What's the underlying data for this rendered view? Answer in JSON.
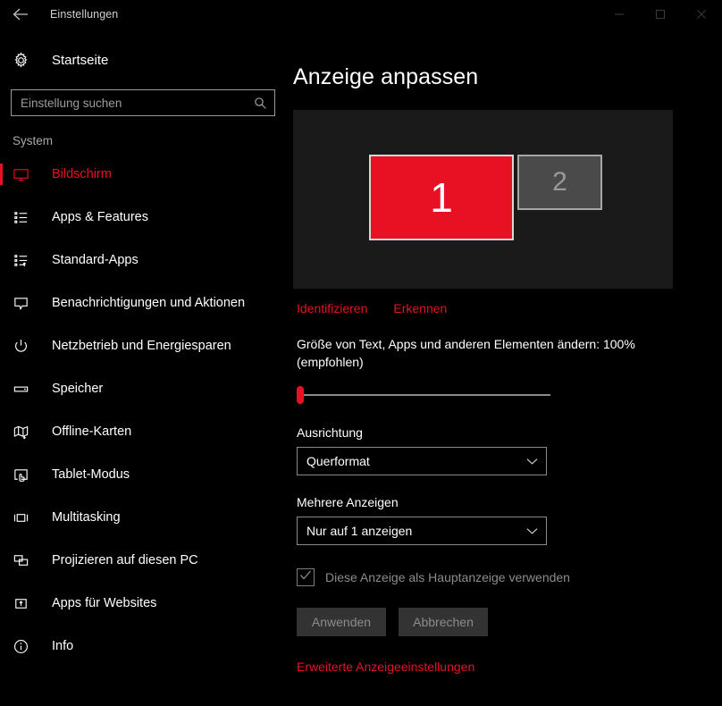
{
  "window": {
    "title": "Einstellungen",
    "back_icon": "back-arrow-icon",
    "minimize_icon": "minimize-icon",
    "maximize_icon": "maximize-icon",
    "close_icon": "close-icon"
  },
  "sidebar": {
    "home": {
      "label": "Startseite",
      "icon": "gear-icon"
    },
    "search": {
      "placeholder": "Einstellung suchen",
      "value": "",
      "icon": "search-icon"
    },
    "section_title": "System",
    "items": [
      {
        "label": "Bildschirm",
        "icon": "monitor-icon",
        "selected": true
      },
      {
        "label": "Apps & Features",
        "icon": "list-bullets-icon",
        "selected": false
      },
      {
        "label": "Standard-Apps",
        "icon": "list-arrow-icon",
        "selected": false
      },
      {
        "label": "Benachrichtigungen und Aktionen",
        "icon": "speech-bubble-icon",
        "selected": false
      },
      {
        "label": "Netzbetrieb und Energiesparen",
        "icon": "power-icon",
        "selected": false
      },
      {
        "label": "Speicher",
        "icon": "drive-icon",
        "selected": false
      },
      {
        "label": "Offline-Karten",
        "icon": "map-icon",
        "selected": false
      },
      {
        "label": "Tablet-Modus",
        "icon": "tablet-touch-icon",
        "selected": false
      },
      {
        "label": "Multitasking",
        "icon": "multitask-icon",
        "selected": false
      },
      {
        "label": "Projizieren auf diesen PC",
        "icon": "project-screens-icon",
        "selected": false
      },
      {
        "label": "Apps für Websites",
        "icon": "app-website-icon",
        "selected": false
      },
      {
        "label": "Info",
        "icon": "info-icon",
        "selected": false
      }
    ]
  },
  "main": {
    "title": "Anzeige anpassen",
    "monitors": [
      {
        "number": "1",
        "primary": true
      },
      {
        "number": "2",
        "primary": false
      }
    ],
    "links": {
      "identify": "Identifizieren",
      "detect": "Erkennen"
    },
    "scaling": {
      "text": "Größe von Text, Apps und anderen Elementen ändern: 100% (empfohlen)",
      "value": "100%",
      "slider_position_percent": 0
    },
    "orientation": {
      "label": "Ausrichtung",
      "value": "Querformat",
      "chevron_icon": "chevron-down-icon"
    },
    "multiple_displays": {
      "label": "Mehrere Anzeigen",
      "value": "Nur auf 1 anzeigen",
      "chevron_icon": "chevron-down-icon"
    },
    "main_display_checkbox": {
      "label": "Diese Anzeige als Hauptanzeige verwenden",
      "checked": true,
      "disabled": true,
      "icon": "checkmark-icon"
    },
    "buttons": {
      "apply": "Anwenden",
      "cancel": "Abbrechen"
    },
    "advanced_link": "Erweiterte Anzeigeeinstellungen"
  },
  "colors": {
    "accent": "#e81123",
    "page_background": "#000000",
    "panel_background": "#1a1a1a",
    "secondary_monitor": "#4a4a4a",
    "disabled_text": "#8c8c8c"
  }
}
